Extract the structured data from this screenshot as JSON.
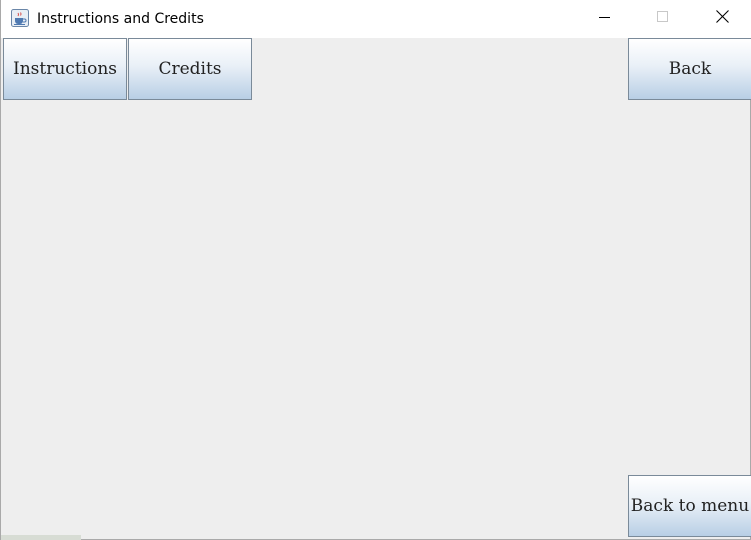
{
  "window": {
    "title": "Instructions and Credits"
  },
  "icons": {
    "app": "java-coffee-cup-icon",
    "minimize": "minimize-icon",
    "maximize": "maximize-icon",
    "close": "close-icon"
  },
  "buttons": {
    "instructions": "Instructions",
    "credits": "Credits",
    "back": "Back",
    "back_to_menu": "Back to menu"
  },
  "colors": {
    "content_background": "#eeeeee",
    "button_gradient_top": "#ffffff",
    "button_gradient_bottom": "#b8cfe5",
    "button_border": "#7a8a99"
  }
}
